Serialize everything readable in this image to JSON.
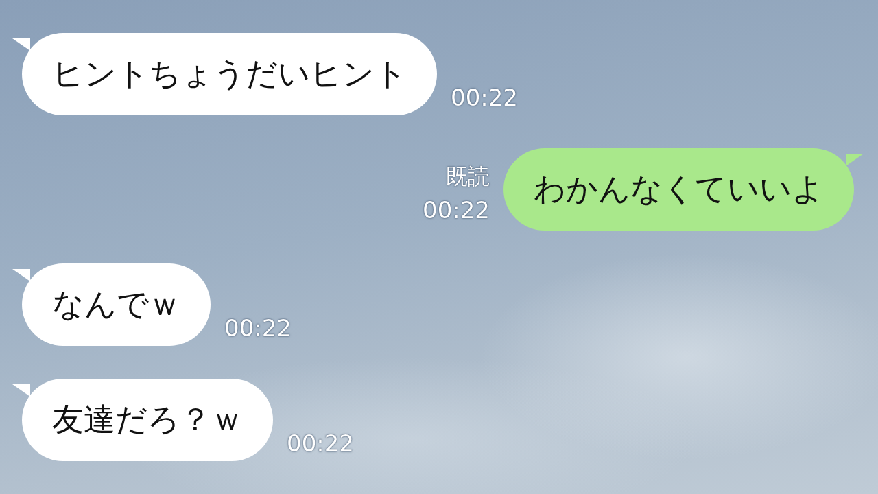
{
  "messages": [
    {
      "kind": "incoming",
      "text": "ヒントちょうだいヒント",
      "time": "00:22"
    },
    {
      "kind": "outgoing",
      "text": "わかんなくていいよ",
      "time": "00:22",
      "read_label": "既読"
    },
    {
      "kind": "incoming",
      "text": "なんでｗ",
      "time": "00:22"
    },
    {
      "kind": "incoming",
      "text": "友達だろ？ｗ",
      "time": "00:22"
    }
  ]
}
